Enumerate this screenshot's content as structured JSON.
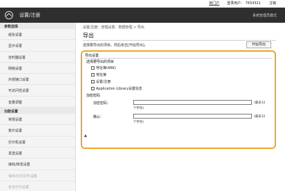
{
  "topbar": {
    "portal": "到门户",
    "user": "登录用户： 7654321",
    "logout": "注销"
  },
  "header": {
    "title": "设置/注册",
    "manager": "系统管理员模式",
    "home_icon": "home-icon"
  },
  "sidebar": {
    "heading1": "参数选择",
    "items1": [
      "纸张设置",
      "显示设置",
      "定时器设置",
      "网络设置",
      "外部接口设置",
      "可访问性设置",
      "音量调整"
    ],
    "heading2": "功能设置",
    "items2": [
      "常规设置",
      "复印设置",
      "打印机设置",
      "发送设置",
      "接收/转发设置",
      "保存/访问文件设置",
      "安全打印设置"
    ]
  },
  "main": {
    "breadcrumb": "设置/注册：管理设置：数据管理 > 导出",
    "title": "导出",
    "instruction": "选择要导出的项目，然后单击[开始导出]。",
    "start_button": "开始导出"
  },
  "panel": {
    "title": "导出设置",
    "select_heading": "选择要导出的项目",
    "checkboxes": [
      "地址簿(ARK)",
      "地址簿",
      "设置/注册",
      "Application Library设置信息"
    ],
    "password_heading": "加密密码",
    "password_label": "加密密码：",
    "password_note": "个字符)",
    "password_hint": "(最多32",
    "confirm_label": "确认：",
    "confirm_note": "个字符)",
    "confirm_hint": "(最多32"
  },
  "footer": {
    "top_link": "▲"
  }
}
